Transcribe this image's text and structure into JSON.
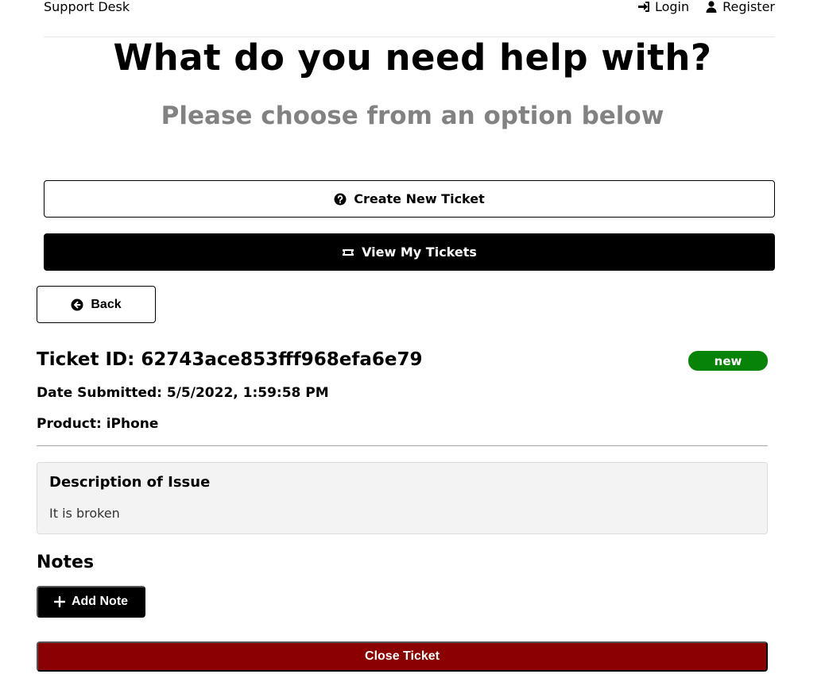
{
  "header": {
    "logo": "Support Desk",
    "nav": {
      "login_label": "Login",
      "register_label": "Register"
    }
  },
  "hero": {
    "title": "What do you need help with?",
    "subtitle": "Please choose from an option below"
  },
  "actions": {
    "create_ticket_label": "Create New Ticket",
    "view_tickets_label": "View My Tickets",
    "back_label": "Back"
  },
  "ticket": {
    "id_line": "Ticket ID: 62743ace853fff968efa6e79",
    "status": "new",
    "status_color": "#078407",
    "date_line": "Date Submitted: 5/5/2022, 1:59:58 PM",
    "product_line": "Product: iPhone",
    "description_heading": "Description of Issue",
    "description_text": "It is broken"
  },
  "notes": {
    "heading": "Notes",
    "add_note_label": "Add Note"
  },
  "close_ticket_label": "Close Ticket",
  "close_ticket_color": "#8b0000",
  "icons": {
    "login": "sign-in-icon",
    "register": "user-icon",
    "create": "question-circle-icon",
    "view": "ticket-icon",
    "back": "arrow-circle-left-icon",
    "add_note": "plus-icon"
  }
}
